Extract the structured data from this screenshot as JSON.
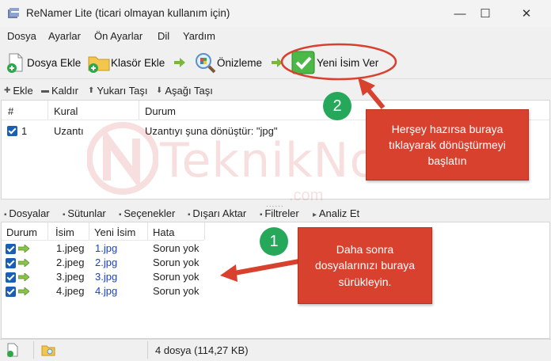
{
  "window": {
    "title": "ReNamer Lite (ticari olmayan kullanım için)",
    "minimize": "—",
    "maximize": "☐",
    "close": "✕"
  },
  "menu": [
    "Dosya",
    "Ayarlar",
    "Ön Ayarlar",
    "Dil",
    "Yardım"
  ],
  "toolbar": {
    "add_files": "Dosya Ekle",
    "add_folder": "Klasör Ekle",
    "preview": "Önizleme",
    "rename": "Yeni İsim Ver"
  },
  "rule_tools": {
    "add": "Ekle",
    "remove": "Kaldır",
    "up": "Yukarı Taşı",
    "down": "Aşağı Taşı"
  },
  "rules": {
    "columns": [
      "#",
      "Kural",
      "Durum"
    ],
    "rows": [
      {
        "num": "1",
        "rule": "Uzantı",
        "status": "Uzantıyı şuna dönüştür: \"jpg\""
      }
    ]
  },
  "splitter": "......",
  "file_tools": [
    "Dosyalar",
    "Sütunlar",
    "Seçenekler",
    "Dışarı Aktar",
    "Filtreler",
    "Analiz Et"
  ],
  "files": {
    "columns": [
      "Durum",
      "İsim",
      "Yeni İsim",
      "Hata"
    ],
    "rows": [
      {
        "name": "1.jpeg",
        "new_name": "1.jpg",
        "error": "Sorun yok"
      },
      {
        "name": "2.jpeg",
        "new_name": "2.jpg",
        "error": "Sorun yok"
      },
      {
        "name": "3.jpeg",
        "new_name": "3.jpg",
        "error": "Sorun yok"
      },
      {
        "name": "4.jpeg",
        "new_name": "4.jpg",
        "error": "Sorun yok"
      }
    ]
  },
  "status": {
    "summary": "4 dosya (114,27 KB)"
  },
  "watermark": {
    "text": "TeknikNot",
    "suffix": ".com"
  },
  "annotations": {
    "step1": {
      "badge": "1",
      "text": "Daha sonra dosyalarınızı buraya sürükleyin."
    },
    "step2": {
      "badge": "2",
      "text": "Herşey hazırsa buraya tıklayarak dönüştürmeyi başlatın"
    }
  },
  "colors": {
    "accent_red": "#d9412f",
    "badge_green": "#26a85a",
    "checkbox_blue": "#1b5fb5",
    "new_name_blue": "#1a3fcf"
  }
}
